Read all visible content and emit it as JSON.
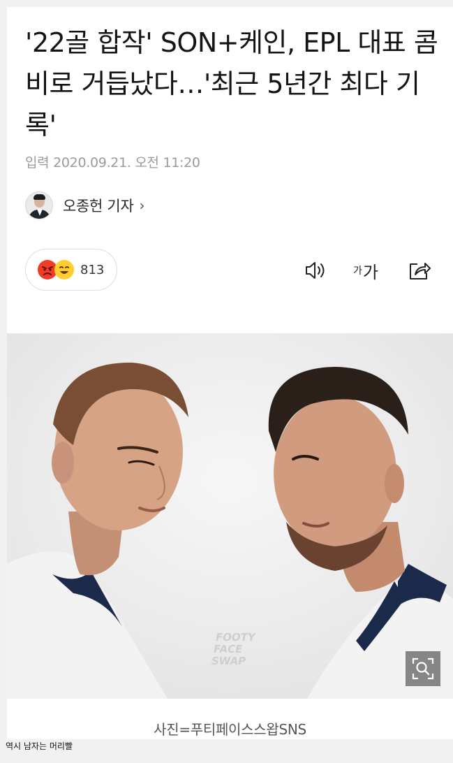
{
  "article": {
    "title": "'22골 합작' SON+케인, EPL 대표 콤비로 거듭났다…'최근 5년간 최다 기록'",
    "dateline": "입력 2020.09.21. 오전 11:20",
    "author_name": "오종헌 기자",
    "author_chevron": "›"
  },
  "reactions": {
    "count": "813",
    "icons": [
      "angry-face-icon",
      "smile-face-icon"
    ]
  },
  "tools": {
    "font_small": "가",
    "font_large": "가",
    "icons": [
      "speaker-icon",
      "font-size-icon",
      "share-icon"
    ]
  },
  "photo": {
    "watermark_lines": [
      "FOOTY",
      "FACE",
      "SWAP"
    ],
    "zoom_icon": "zoom-search-icon"
  },
  "caption": "사진=푸티페이스스왑SNS",
  "footer_text": "역시 남자는 머리빨",
  "colors": {
    "background": "#f1f1f1",
    "card": "#ffffff",
    "angry_face": "#ef3b28",
    "smile_face": "#ffce2e",
    "meta_gray": "#9a9a9a"
  }
}
